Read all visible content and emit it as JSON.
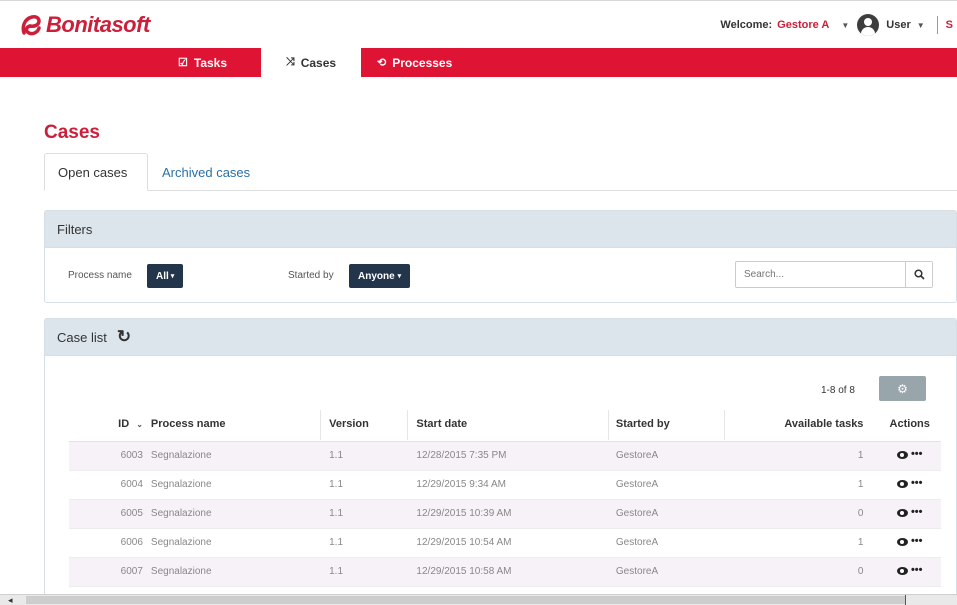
{
  "brand": {
    "name": "Bonitasoft"
  },
  "header": {
    "welcome_label": "Welcome:",
    "profile": "Gestore A",
    "user_label": "User",
    "cut_link": "S"
  },
  "nav": {
    "tasks": "Tasks",
    "cases": "Cases",
    "processes": "Processes"
  },
  "page": {
    "title": "Cases",
    "tabs": [
      "Open cases",
      "Archived cases"
    ]
  },
  "filters": {
    "title": "Filters",
    "process_label": "Process name",
    "process_value": "All",
    "started_by_label": "Started by",
    "started_by_value": "Anyone",
    "search_placeholder": "Search..."
  },
  "caselist": {
    "title": "Case list",
    "pager": "1-8 of 8",
    "columns": [
      "ID",
      "Process name",
      "Version",
      "Start date",
      "Started by",
      "Available tasks",
      "Actions"
    ],
    "rows": [
      {
        "id": "6003",
        "process": "Segnalazione",
        "version": "1.1",
        "start": "12/28/2015 7:35 PM",
        "by": "GestoreA",
        "tasks": "1"
      },
      {
        "id": "6004",
        "process": "Segnalazione",
        "version": "1.1",
        "start": "12/29/2015 9:34 AM",
        "by": "GestoreA",
        "tasks": "1"
      },
      {
        "id": "6005",
        "process": "Segnalazione",
        "version": "1.1",
        "start": "12/29/2015 10:39 AM",
        "by": "GestoreA",
        "tasks": "0"
      },
      {
        "id": "6006",
        "process": "Segnalazione",
        "version": "1.1",
        "start": "12/29/2015 10:54 AM",
        "by": "GestoreA",
        "tasks": "1"
      },
      {
        "id": "6007",
        "process": "Segnalazione",
        "version": "1.1",
        "start": "12/29/2015 10:58 AM",
        "by": "GestoreA",
        "tasks": "0"
      }
    ]
  },
  "colors": {
    "brand_red": "#df1434",
    "title_red": "#cc1f3a",
    "link_blue": "#2a6fa8",
    "button_dark": "#22354a"
  },
  "icons": {
    "tasks": "check-square-icon",
    "cases": "shuffle-icon",
    "processes": "process-icon",
    "refresh": "refresh-icon",
    "settings": "gear-icon",
    "search": "search-icon",
    "view": "eye-icon",
    "more": "ellipsis-icon"
  }
}
